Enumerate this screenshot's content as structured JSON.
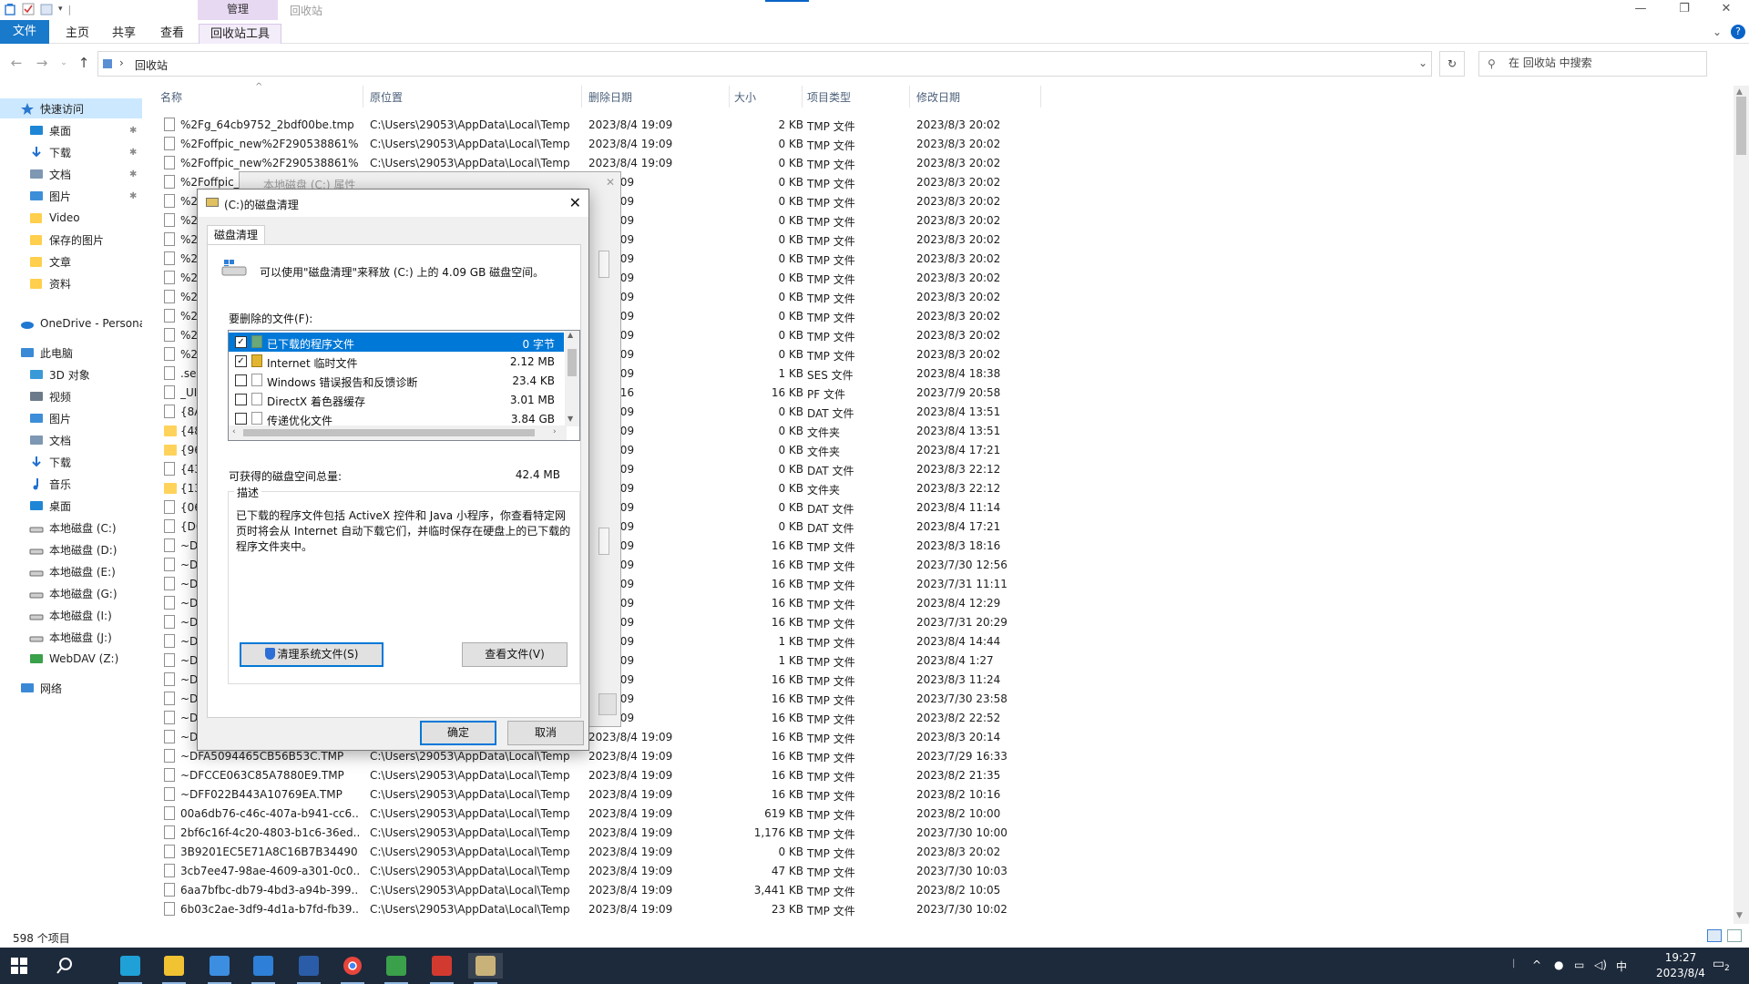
{
  "window": {
    "context_tab": "管理",
    "title": "回收站",
    "minimize": "—",
    "restore": "❐",
    "close": "✕"
  },
  "ribbon": {
    "tabs": [
      "文件",
      "主页",
      "共享",
      "查看",
      "回收站工具"
    ],
    "help": "?"
  },
  "address": {
    "path": "回收站",
    "search_placeholder": "在 回收站 中搜索"
  },
  "sidebar": {
    "items": [
      {
        "label": "快速访问",
        "icon": "star-icon",
        "color": "#2b78d0",
        "pinned": false
      },
      {
        "label": "桌面",
        "icon": "desktop-icon",
        "color": "#1f86d6",
        "pinned": true
      },
      {
        "label": "下载",
        "icon": "download-icon",
        "color": "#1f6fd0",
        "pinned": true
      },
      {
        "label": "文档",
        "icon": "document-icon",
        "color": "#7e97b2",
        "pinned": true
      },
      {
        "label": "图片",
        "icon": "picture-icon",
        "color": "#3d8ed8",
        "pinned": true
      },
      {
        "label": "Video",
        "icon": "folder-icon",
        "color": "#ffcf4d",
        "pinned": false
      },
      {
        "label": "保存的图片",
        "icon": "folder-icon",
        "color": "#ffcf4d",
        "pinned": false
      },
      {
        "label": "文章",
        "icon": "folder-icon",
        "color": "#ffcf4d",
        "pinned": false
      },
      {
        "label": "资料",
        "icon": "folder-icon",
        "color": "#ffcf4d",
        "pinned": false
      },
      {
        "label": "OneDrive - Persona",
        "icon": "cloud-icon",
        "color": "#1f78d1",
        "pinned": false
      },
      {
        "label": "此电脑",
        "icon": "computer-icon",
        "color": "#3a89d6",
        "pinned": false
      },
      {
        "label": "3D 对象",
        "icon": "cube-icon",
        "color": "#3a9ad8",
        "pinned": false
      },
      {
        "label": "视频",
        "icon": "video-icon",
        "color": "#6c7a8a",
        "pinned": false
      },
      {
        "label": "图片",
        "icon": "picture-icon",
        "color": "#3d8ed8",
        "pinned": false
      },
      {
        "label": "文档",
        "icon": "document-icon",
        "color": "#7e97b2",
        "pinned": false
      },
      {
        "label": "下载",
        "icon": "download-icon",
        "color": "#1f6fd0",
        "pinned": false
      },
      {
        "label": "音乐",
        "icon": "music-icon",
        "color": "#1f6fd0",
        "pinned": false
      },
      {
        "label": "桌面",
        "icon": "desktop-icon",
        "color": "#1f86d6",
        "pinned": false
      },
      {
        "label": "本地磁盘 (C:)",
        "icon": "drive-icon",
        "color": "#6b6b6b",
        "pinned": false
      },
      {
        "label": "本地磁盘 (D:)",
        "icon": "drive-icon",
        "color": "#6b6b6b",
        "pinned": false
      },
      {
        "label": "本地磁盘 (E:)",
        "icon": "drive-icon",
        "color": "#6b6b6b",
        "pinned": false
      },
      {
        "label": "本地磁盘 (G:)",
        "icon": "drive-icon",
        "color": "#6b6b6b",
        "pinned": false
      },
      {
        "label": "本地磁盘 (I:)",
        "icon": "drive-icon",
        "color": "#6b6b6b",
        "pinned": false
      },
      {
        "label": "本地磁盘 (J:)",
        "icon": "drive-icon",
        "color": "#6b6b6b",
        "pinned": false
      },
      {
        "label": "WebDAV (Z:)",
        "icon": "network-drive-icon",
        "color": "#3aa04a",
        "pinned": false
      },
      {
        "label": "网络",
        "icon": "network-icon",
        "color": "#3a89d6",
        "pinned": false
      }
    ]
  },
  "columns": [
    "名称",
    "原位置",
    "删除日期",
    "大小",
    "项目类型",
    "修改日期"
  ],
  "files": [
    {
      "name": "%2Fg_64cb9752_2bdf00be.tmp",
      "orig": "C:\\Users\\29053\\AppData\\Local\\Temp",
      "del": "2023/8/4 19:09",
      "size": "2 KB",
      "type": "TMP 文件",
      "mod": "2023/8/3 20:02",
      "folder": false
    },
    {
      "name": "%2Foffpic_new%2F290538861%...",
      "orig": "C:\\Users\\29053\\AppData\\Local\\Temp",
      "del": "2023/8/4 19:09",
      "size": "0 KB",
      "type": "TMP 文件",
      "mod": "2023/8/3 20:02",
      "folder": false
    },
    {
      "name": "%2Foffpic_new%2F290538861%...",
      "orig": "C:\\Users\\29053\\AppData\\Local\\Temp",
      "del": "2023/8/4 19:09",
      "size": "0 KB",
      "type": "TMP 文件",
      "mod": "2023/8/3 20:02",
      "folder": false
    },
    {
      "name": "%2Foffpic_",
      "orig": "",
      "del": "/4 19:09",
      "size": "0 KB",
      "type": "TMP 文件",
      "mod": "2023/8/3 20:02",
      "folder": false
    },
    {
      "name": "%2",
      "orig": "",
      "del": "/4 19:09",
      "size": "0 KB",
      "type": "TMP 文件",
      "mod": "2023/8/3 20:02",
      "folder": false
    },
    {
      "name": "%2",
      "orig": "",
      "del": "/4 19:09",
      "size": "0 KB",
      "type": "TMP 文件",
      "mod": "2023/8/3 20:02",
      "folder": false
    },
    {
      "name": "%2",
      "orig": "",
      "del": "/4 19:09",
      "size": "0 KB",
      "type": "TMP 文件",
      "mod": "2023/8/3 20:02",
      "folder": false
    },
    {
      "name": "%2",
      "orig": "",
      "del": "/4 19:09",
      "size": "0 KB",
      "type": "TMP 文件",
      "mod": "2023/8/3 20:02",
      "folder": false
    },
    {
      "name": "%2",
      "orig": "",
      "del": "/4 19:09",
      "size": "0 KB",
      "type": "TMP 文件",
      "mod": "2023/8/3 20:02",
      "folder": false
    },
    {
      "name": "%2",
      "orig": "",
      "del": "/4 19:09",
      "size": "0 KB",
      "type": "TMP 文件",
      "mod": "2023/8/3 20:02",
      "folder": false
    },
    {
      "name": "%2",
      "orig": "",
      "del": "/4 19:09",
      "size": "0 KB",
      "type": "TMP 文件",
      "mod": "2023/8/3 20:02",
      "folder": false
    },
    {
      "name": "%2",
      "orig": "",
      "del": "/4 19:09",
      "size": "0 KB",
      "type": "TMP 文件",
      "mod": "2023/8/3 20:02",
      "folder": false
    },
    {
      "name": "%2",
      "orig": "",
      "del": "/4 19:09",
      "size": "0 KB",
      "type": "TMP 文件",
      "mod": "2023/8/3 20:02",
      "folder": false
    },
    {
      "name": ".se",
      "orig": "",
      "del": "/4 19:09",
      "size": "1 KB",
      "type": "SES 文件",
      "mod": "2023/8/4 18:38",
      "folder": false
    },
    {
      "name": "_UI",
      "orig": "",
      "del": "/4 19:16",
      "size": "16 KB",
      "type": "PF 文件",
      "mod": "2023/7/9 20:58",
      "folder": false
    },
    {
      "name": "{8A",
      "orig": "",
      "del": "/4 19:09",
      "size": "0 KB",
      "type": "DAT 文件",
      "mod": "2023/8/4 13:51",
      "folder": false
    },
    {
      "name": "{48",
      "orig": "",
      "del": "/4 19:09",
      "size": "0 KB",
      "type": "文件夹",
      "mod": "2023/8/4 13:51",
      "folder": true
    },
    {
      "name": "{96",
      "orig": "",
      "del": "/4 19:09",
      "size": "0 KB",
      "type": "文件夹",
      "mod": "2023/8/4 17:21",
      "folder": true
    },
    {
      "name": "{43",
      "orig": "",
      "del": "/4 19:09",
      "size": "0 KB",
      "type": "DAT 文件",
      "mod": "2023/8/3 22:12",
      "folder": false
    },
    {
      "name": "{13",
      "orig": "",
      "del": "/4 19:09",
      "size": "0 KB",
      "type": "文件夹",
      "mod": "2023/8/3 22:12",
      "folder": true
    },
    {
      "name": "{06",
      "orig": "",
      "del": "/4 19:09",
      "size": "0 KB",
      "type": "DAT 文件",
      "mod": "2023/8/4 11:14",
      "folder": false
    },
    {
      "name": "{D0",
      "orig": "",
      "del": "/4 19:09",
      "size": "0 KB",
      "type": "DAT 文件",
      "mod": "2023/8/4 17:21",
      "folder": false
    },
    {
      "name": "~D",
      "orig": "",
      "del": "/4 19:09",
      "size": "16 KB",
      "type": "TMP 文件",
      "mod": "2023/8/3 18:16",
      "folder": false
    },
    {
      "name": "~D",
      "orig": "",
      "del": "/4 19:09",
      "size": "16 KB",
      "type": "TMP 文件",
      "mod": "2023/7/30 12:56",
      "folder": false
    },
    {
      "name": "~D",
      "orig": "",
      "del": "/4 19:09",
      "size": "16 KB",
      "type": "TMP 文件",
      "mod": "2023/7/31 11:11",
      "folder": false
    },
    {
      "name": "~D",
      "orig": "",
      "del": "/4 19:09",
      "size": "16 KB",
      "type": "TMP 文件",
      "mod": "2023/8/4 12:29",
      "folder": false
    },
    {
      "name": "~D",
      "orig": "",
      "del": "/4 19:09",
      "size": "16 KB",
      "type": "TMP 文件",
      "mod": "2023/7/31 20:29",
      "folder": false
    },
    {
      "name": "~D",
      "orig": "",
      "del": "/4 19:09",
      "size": "1 KB",
      "type": "TMP 文件",
      "mod": "2023/8/4 14:44",
      "folder": false
    },
    {
      "name": "~D",
      "orig": "",
      "del": "/4 19:09",
      "size": "1 KB",
      "type": "TMP 文件",
      "mod": "2023/8/4 1:27",
      "folder": false
    },
    {
      "name": "~D",
      "orig": "",
      "del": "/4 19:09",
      "size": "16 KB",
      "type": "TMP 文件",
      "mod": "2023/8/3 11:24",
      "folder": false
    },
    {
      "name": "~D",
      "orig": "",
      "del": "/4 19:09",
      "size": "16 KB",
      "type": "TMP 文件",
      "mod": "2023/7/30 23:58",
      "folder": false
    },
    {
      "name": "~D",
      "orig": "",
      "del": "/4 19:09",
      "size": "16 KB",
      "type": "TMP 文件",
      "mod": "2023/8/2 22:52",
      "folder": false
    },
    {
      "name": "~D",
      "orig": "",
      "del": "2023/8/4 19:09",
      "size": "16 KB",
      "type": "TMP 文件",
      "mod": "2023/8/3 20:14",
      "folder": false
    },
    {
      "name": "~DFA5094465CB56B53C.TMP",
      "orig": "C:\\Users\\29053\\AppData\\Local\\Temp",
      "del": "2023/8/4 19:09",
      "size": "16 KB",
      "type": "TMP 文件",
      "mod": "2023/7/29 16:33",
      "folder": false
    },
    {
      "name": "~DFCCE063C85A7880E9.TMP",
      "orig": "C:\\Users\\29053\\AppData\\Local\\Temp",
      "del": "2023/8/4 19:09",
      "size": "16 KB",
      "type": "TMP 文件",
      "mod": "2023/8/2 21:35",
      "folder": false
    },
    {
      "name": "~DFF022B443A10769EA.TMP",
      "orig": "C:\\Users\\29053\\AppData\\Local\\Temp",
      "del": "2023/8/4 19:09",
      "size": "16 KB",
      "type": "TMP 文件",
      "mod": "2023/8/2 10:16",
      "folder": false
    },
    {
      "name": "00a6db76-c46c-407a-b941-cc6...",
      "orig": "C:\\Users\\29053\\AppData\\Local\\Temp",
      "del": "2023/8/4 19:09",
      "size": "619 KB",
      "type": "TMP 文件",
      "mod": "2023/8/2 10:00",
      "folder": false
    },
    {
      "name": "2bf6c16f-4c20-4803-b1c6-36ed...",
      "orig": "C:\\Users\\29053\\AppData\\Local\\Temp",
      "del": "2023/8/4 19:09",
      "size": "1,176 KB",
      "type": "TMP 文件",
      "mod": "2023/7/30 10:00",
      "folder": false
    },
    {
      "name": "3B9201EC5E71A8C16B7B34490...",
      "orig": "C:\\Users\\29053\\AppData\\Local\\Temp",
      "del": "2023/8/4 19:09",
      "size": "0 KB",
      "type": "TMP 文件",
      "mod": "2023/8/3 20:02",
      "folder": false
    },
    {
      "name": "3cb7ee47-98ae-4609-a301-0c0...",
      "orig": "C:\\Users\\29053\\AppData\\Local\\Temp",
      "del": "2023/8/4 19:09",
      "size": "47 KB",
      "type": "TMP 文件",
      "mod": "2023/7/30 10:03",
      "folder": false
    },
    {
      "name": "6aa7bfbc-db79-4bd3-a94b-399...",
      "orig": "C:\\Users\\29053\\AppData\\Local\\Temp",
      "del": "2023/8/4 19:09",
      "size": "3,441 KB",
      "type": "TMP 文件",
      "mod": "2023/8/2 10:05",
      "folder": false
    },
    {
      "name": "6b03c2ae-3df9-4d1a-b7fd-fb39...",
      "orig": "C:\\Users\\29053\\AppData\\Local\\Temp",
      "del": "2023/8/4 19:09",
      "size": "23 KB",
      "type": "TMP 文件",
      "mod": "2023/7/30 10:02",
      "folder": false
    }
  ],
  "status": {
    "count": "598 个项目"
  },
  "bg_dialog": {
    "title": "本地磁盘 (C:) 属性",
    "close": "✕"
  },
  "dialog": {
    "title": "(C:)的磁盘清理",
    "close": "✕",
    "tab": "磁盘清理",
    "intro": "可以使用\"磁盘清理\"来释放 (C:) 上的 4.09 GB 磁盘空间。",
    "files_label": "要删除的文件(F):",
    "items": [
      {
        "label": "已下载的程序文件",
        "size": "0 字节",
        "checked": true,
        "selected": true
      },
      {
        "label": "Internet 临时文件",
        "size": "2.12 MB",
        "checked": true,
        "selected": false
      },
      {
        "label": "Windows 错误报告和反馈诊断",
        "size": "23.4 KB",
        "checked": false,
        "selected": false
      },
      {
        "label": "DirectX 着色器缓存",
        "size": "3.01 MB",
        "checked": false,
        "selected": false
      },
      {
        "label": "传递优化文件",
        "size": "3.84 GB",
        "checked": false,
        "selected": false
      }
    ],
    "total_label": "可获得的磁盘空间总量:",
    "total_value": "42.4 MB",
    "desc_legend": "描述",
    "desc_text": "已下载的程序文件包括 ActiveX 控件和 Java 小程序，你查看特定网页时将会从 Internet 自动下载它们，并临时保存在硬盘上的已下载的程序文件夹中。",
    "clean_system_button": "清理系统文件(S)",
    "view_files_button": "查看文件(V)",
    "ok_button": "确定",
    "cancel_button": "取消"
  },
  "taskbar": {
    "apps": [
      {
        "name": "start-button",
        "color": "#ffffff"
      },
      {
        "name": "search-button",
        "color": "#ffffff"
      },
      {
        "name": "edge-app",
        "color": "#1fa1d8"
      },
      {
        "name": "file-explorer-app",
        "color": "#f1c232"
      },
      {
        "name": "store-app",
        "color": "#3c8ee0"
      },
      {
        "name": "mail-app",
        "color": "#2d7fd8"
      },
      {
        "name": "word-app",
        "color": "#2b5ca8"
      },
      {
        "name": "chrome-app",
        "color": "#e8453c"
      },
      {
        "name": "app-7",
        "color": "#3aa04a"
      },
      {
        "name": "app-8",
        "color": "#d33a2f"
      },
      {
        "name": "disk-cleanup-app",
        "color": "#c9b27a"
      }
    ],
    "ime": "中",
    "time": "19:27",
    "date": "2023/8/4",
    "notifications": "2"
  }
}
